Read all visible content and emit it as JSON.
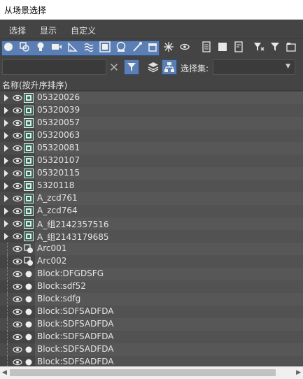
{
  "window": {
    "title": "从场景选择"
  },
  "menu": {
    "items": [
      "选择",
      "显示",
      "自定义"
    ]
  },
  "toolbar": {
    "filter_icons": [
      "geometry-icon",
      "shapes-icon",
      "lights-icon",
      "cameras-icon",
      "helpers-icon",
      "spacewarps-icon",
      "groups-icon",
      "xrefs-icon",
      "bones-icon",
      "containers-icon",
      "frozen-icon",
      "hidden-icon"
    ],
    "selection_set_label": "选择集:",
    "selection_set_value": ""
  },
  "search": {
    "value": "",
    "placeholder": ""
  },
  "column_header": "名称(按升序排序)",
  "rows": [
    {
      "name": "05320026",
      "type": "group",
      "expandable": true
    },
    {
      "name": "05320039",
      "type": "group",
      "expandable": true
    },
    {
      "name": "05320057",
      "type": "group",
      "expandable": true
    },
    {
      "name": "05320063",
      "type": "group",
      "expandable": true
    },
    {
      "name": "05320081",
      "type": "group",
      "expandable": true
    },
    {
      "name": "05320107",
      "type": "group",
      "expandable": true
    },
    {
      "name": "05320115",
      "type": "group",
      "expandable": true
    },
    {
      "name": "5320118",
      "type": "group",
      "expandable": true
    },
    {
      "name": "A_zcd761",
      "type": "group",
      "expandable": true
    },
    {
      "name": "A_zcd764",
      "type": "group",
      "expandable": true
    },
    {
      "name": "A_组2142357516",
      "type": "group",
      "expandable": true
    },
    {
      "name": "A_组2143179685",
      "type": "group",
      "expandable": true
    },
    {
      "name": "Arc001",
      "type": "shape",
      "expandable": false
    },
    {
      "name": "Arc002",
      "type": "shape",
      "expandable": false
    },
    {
      "name": "Block:DFGDSFG",
      "type": "block",
      "expandable": false
    },
    {
      "name": "Block:sdf52",
      "type": "block",
      "expandable": false
    },
    {
      "name": "Block:sdfg",
      "type": "block",
      "expandable": false
    },
    {
      "name": "Block:SDFSADFDA",
      "type": "block",
      "expandable": false
    },
    {
      "name": "Block:SDFSADFDA",
      "type": "block",
      "expandable": false
    },
    {
      "name": "Block:SDFSADFDA",
      "type": "block",
      "expandable": false
    },
    {
      "name": "Block:SDFSADFDA",
      "type": "block",
      "expandable": false
    },
    {
      "name": "Block:SDFSADFDA",
      "type": "block",
      "expandable": false
    }
  ],
  "colors": {
    "accent": "#5b7fb4",
    "background": "#444444"
  }
}
